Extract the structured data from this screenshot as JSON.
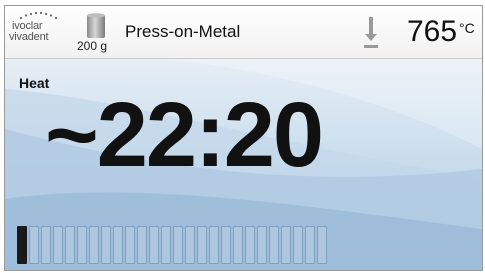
{
  "header": {
    "logo_line1": "ivoclar",
    "logo_line2": "vivadent",
    "weight": "200 g",
    "program": "Press-on-Metal",
    "temperature": "765",
    "temperature_unit": "°C",
    "icons": [
      "ivoclar-vivadent-logo",
      "crucible-icon",
      "thermometer-down-icon"
    ]
  },
  "main": {
    "phase": "Heat",
    "time": "~22:20"
  },
  "progress": {
    "segments": 26,
    "filled": 1
  },
  "colors": {
    "background_top": "#e6eef6",
    "background_bottom": "#a9c6e0",
    "text": "#111111",
    "segment_filled": "#1a1a1a"
  }
}
